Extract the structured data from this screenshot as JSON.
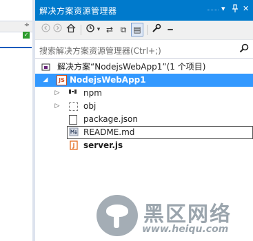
{
  "panel": {
    "title": "解决方案资源管理器",
    "controls": [
      "▾",
      "ᚁ",
      "✕"
    ]
  },
  "toolbar": {
    "back": "◀",
    "forward": "▶",
    "home": "⌂",
    "history": "⟲",
    "history_drop": "▾",
    "sync": "⇄",
    "collapse": "⧉",
    "show_all": "▤",
    "properties": "🔧",
    "preview": "━"
  },
  "search": {
    "placeholder": "搜索解决方案资源管理器(Ctrl+;)"
  },
  "tree": {
    "solution": "解决方案“NodejsWebApp1”(1 个项目)",
    "project": "NodejsWebApp1",
    "project_badge": "JS",
    "items": [
      {
        "label": "npm",
        "icon": "npm-icon",
        "expandable": true
      },
      {
        "label": "obj",
        "icon": "folder-icon",
        "expandable": true
      },
      {
        "label": "package.json",
        "icon": "file-icon",
        "expandable": false
      },
      {
        "label": "README.md",
        "icon": "markdown-icon",
        "expandable": false
      },
      {
        "label": "server.js",
        "icon": "js-file-icon",
        "expandable": false
      }
    ]
  },
  "left": {
    "check": "✓",
    "scroll": "÷"
  },
  "watermark": {
    "text": "黑区网络",
    "url": "www.heiqu.com"
  }
}
